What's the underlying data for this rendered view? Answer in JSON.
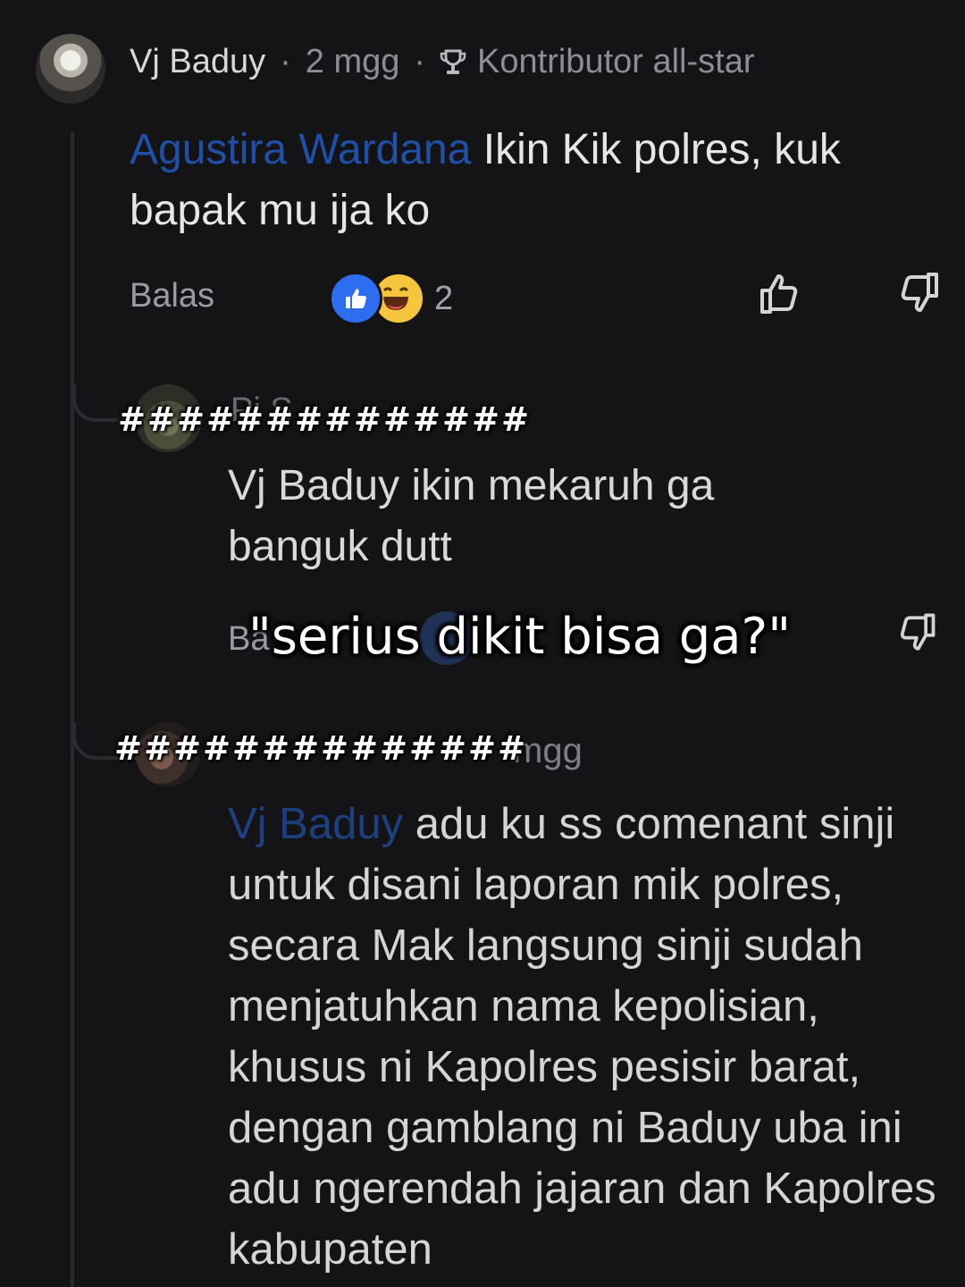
{
  "comment": {
    "author": "Vj Baduy",
    "time": "2 mgg",
    "badge": "Kontributor all-star",
    "mention": "Agustira Wardana",
    "text": "Ikin Kik polres, kuk bapak mu ija ko",
    "reply_label": "Balas",
    "reaction_count": "2",
    "reactions": [
      "like",
      "haha"
    ]
  },
  "reply1": {
    "name_partial": "Pi    S",
    "text_line1": "Vj Baduy ikin mekaruh ga",
    "text_line2": "banguk dutt",
    "reply_label_partial": "Ba"
  },
  "reply2": {
    "time": "mgg",
    "mention": "Vj Baduy",
    "text": "adu ku ss comenant sinji untuk disani laporan mik polres, secara Mak langsung sinji sudah menjatuhkan nama kepolisian, khusus ni Kapolres pesisir barat, dengan gamblang ni Baduy uba ini adu ngerendah jajaran dan Kapolres kabupaten"
  },
  "overlay": {
    "hash_top": "##############",
    "hash_bottom": "##############",
    "caption": "\"serius dikit bisa ga?\""
  },
  "colors": {
    "background": "#141416",
    "mention": "#1f4fa6",
    "like": "#2d6df0",
    "haha": "#f4c53d"
  }
}
